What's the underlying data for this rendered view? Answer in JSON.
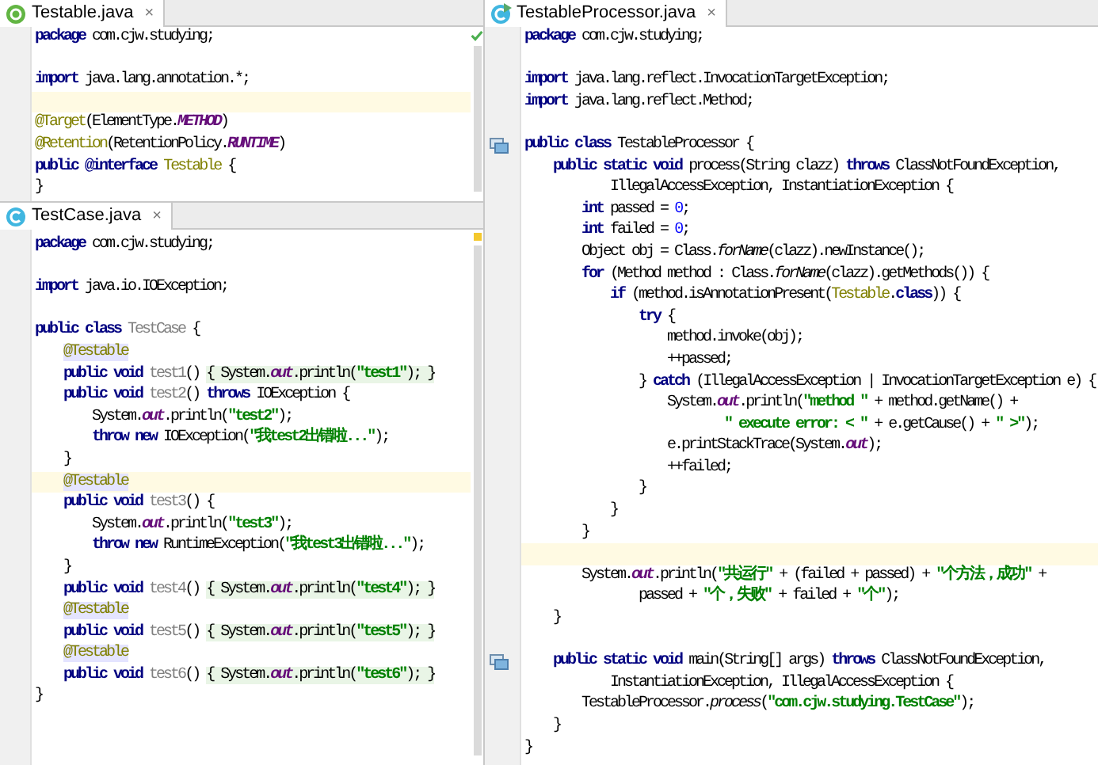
{
  "panes": [
    {
      "tab": {
        "label": "Testable.java",
        "close": "×",
        "selected": true
      },
      "lines": [
        {
          "current": false,
          "tokens": [
            {
              "kind": "keyword",
              "text": "package"
            },
            {
              "kind": "plain",
              "text": " com.cjw.studying;"
            }
          ]
        },
        {
          "current": false
        },
        {
          "current": false,
          "tokens": [
            {
              "kind": "keyword",
              "text": "import"
            },
            {
              "kind": "plain",
              "text": " java.lang.annotation.*;"
            }
          ]
        },
        {
          "current": true
        },
        {
          "current": false,
          "tokens": [
            {
              "kind": "annotation",
              "text": "@Target"
            },
            {
              "kind": "plain",
              "text": "(ElementType."
            },
            {
              "kind": "constant",
              "text": "METHOD"
            },
            {
              "kind": "plain",
              "text": ")"
            }
          ]
        },
        {
          "current": false,
          "tokens": [
            {
              "kind": "annotation",
              "text": "@Retention"
            },
            {
              "kind": "plain",
              "text": "(RetentionPolicy."
            },
            {
              "kind": "constant",
              "text": "RUNTIME"
            },
            {
              "kind": "plain",
              "text": ")"
            }
          ]
        },
        {
          "current": false,
          "tokens": [
            {
              "kind": "keyword",
              "text": "public"
            },
            {
              "kind": "keyword",
              "text": " @interface"
            },
            {
              "kind": "annotation",
              "text": " Testable"
            },
            {
              "kind": "plain",
              "text": " {"
            }
          ]
        },
        {
          "current": false,
          "tokens": [
            {
              "kind": "plain",
              "text": "}"
            }
          ]
        }
      ]
    },
    {
      "tab": {
        "label": "TestCase.java",
        "close": "×",
        "selected": true
      },
      "lines": [
        {
          "current": false,
          "tokens": [
            {
              "kind": "keyword",
              "text": "package"
            },
            {
              "kind": "plain",
              "text": " com.cjw.studying;"
            }
          ]
        },
        {
          "current": false
        },
        {
          "current": false,
          "tokens": [
            {
              "kind": "keyword",
              "text": "import"
            },
            {
              "kind": "plain",
              "text": " java.io.IOException;"
            }
          ]
        },
        {
          "current": false
        },
        {
          "current": false,
          "tokens": [
            {
              "kind": "keyword",
              "text": "public class"
            },
            {
              "kind": "unused",
              "text": " TestCase"
            },
            {
              "kind": "plain",
              "text": " {"
            }
          ]
        },
        {
          "current": false,
          "tokens": [
            {
              "kind": "usage",
              "text": "    @Testable"
            }
          ]
        },
        {
          "current": false,
          "tokens": [
            {
              "kind": "keyword",
              "text": "    public void"
            },
            {
              "kind": "unused",
              "text": " test1"
            },
            {
              "kind": "plain",
              "text": "() "
            }
          ],
          "fold": [
            {
              "kind": "plain",
              "text": "{ System."
            },
            {
              "kind": "field",
              "text": "out"
            },
            {
              "kind": "plain",
              "text": ".println("
            },
            {
              "kind": "string",
              "text": "\"test1\""
            },
            {
              "kind": "plain",
              "text": "); }"
            }
          ]
        },
        {
          "current": false,
          "tokens": [
            {
              "kind": "keyword",
              "text": "    public void"
            },
            {
              "kind": "unused",
              "text": " test2"
            },
            {
              "kind": "plain",
              "text": "() "
            },
            {
              "kind": "keyword",
              "text": "throws"
            },
            {
              "kind": "plain",
              "text": " IOException {"
            }
          ]
        },
        {
          "current": false,
          "tokens": [
            {
              "kind": "plain",
              "text": "        System."
            },
            {
              "kind": "field",
              "text": "out"
            },
            {
              "kind": "plain",
              "text": ".println("
            },
            {
              "kind": "string",
              "text": "\"test2\""
            },
            {
              "kind": "plain",
              "text": ");"
            }
          ]
        },
        {
          "current": false,
          "tokens": [
            {
              "kind": "keyword",
              "text": "        throw new"
            },
            {
              "kind": "plain",
              "text": " IOException("
            },
            {
              "kind": "string",
              "text": "\"我test2出错啦...\""
            },
            {
              "kind": "plain",
              "text": ");"
            }
          ]
        },
        {
          "current": false,
          "tokens": [
            {
              "kind": "plain",
              "text": "    }"
            }
          ]
        },
        {
          "current": true,
          "tokens": [
            {
              "kind": "usage",
              "text": "    @Testable"
            }
          ]
        },
        {
          "current": false,
          "tokens": [
            {
              "kind": "keyword",
              "text": "    public void"
            },
            {
              "kind": "unused",
              "text": " test3"
            },
            {
              "kind": "plain",
              "text": "() {"
            }
          ]
        },
        {
          "current": false,
          "tokens": [
            {
              "kind": "plain",
              "text": "        System."
            },
            {
              "kind": "field",
              "text": "out"
            },
            {
              "kind": "plain",
              "text": ".println("
            },
            {
              "kind": "string",
              "text": "\"test3\""
            },
            {
              "kind": "plain",
              "text": ");"
            }
          ]
        },
        {
          "current": false,
          "tokens": [
            {
              "kind": "keyword",
              "text": "        throw new"
            },
            {
              "kind": "plain",
              "text": " RuntimeException("
            },
            {
              "kind": "string",
              "text": "\"我test3出错啦...\""
            },
            {
              "kind": "plain",
              "text": ");"
            }
          ]
        },
        {
          "current": false,
          "tokens": [
            {
              "kind": "plain",
              "text": "    }"
            }
          ]
        },
        {
          "current": false,
          "tokens": [
            {
              "kind": "keyword",
              "text": "    public void"
            },
            {
              "kind": "unused",
              "text": " test4"
            },
            {
              "kind": "plain",
              "text": "() "
            }
          ],
          "fold": [
            {
              "kind": "plain",
              "text": "{ System."
            },
            {
              "kind": "field",
              "text": "out"
            },
            {
              "kind": "plain",
              "text": ".println("
            },
            {
              "kind": "string",
              "text": "\"test4\""
            },
            {
              "kind": "plain",
              "text": "); }"
            }
          ]
        },
        {
          "current": false,
          "tokens": [
            {
              "kind": "usage",
              "text": "    @Testable"
            }
          ]
        },
        {
          "current": false,
          "tokens": [
            {
              "kind": "keyword",
              "text": "    public void"
            },
            {
              "kind": "unused",
              "text": " test5"
            },
            {
              "kind": "plain",
              "text": "() "
            }
          ],
          "fold": [
            {
              "kind": "plain",
              "text": "{ System."
            },
            {
              "kind": "field",
              "text": "out"
            },
            {
              "kind": "plain",
              "text": ".println("
            },
            {
              "kind": "string",
              "text": "\"test5\""
            },
            {
              "kind": "plain",
              "text": "); }"
            }
          ]
        },
        {
          "current": false,
          "tokens": [
            {
              "kind": "usage",
              "text": "    @Testable"
            }
          ]
        },
        {
          "current": false,
          "tokens": [
            {
              "kind": "keyword",
              "text": "    public void"
            },
            {
              "kind": "unused",
              "text": " test6"
            },
            {
              "kind": "plain",
              "text": "() "
            }
          ],
          "fold": [
            {
              "kind": "plain",
              "text": "{ System."
            },
            {
              "kind": "field",
              "text": "out"
            },
            {
              "kind": "plain",
              "text": ".println("
            },
            {
              "kind": "string",
              "text": "\"test6\""
            },
            {
              "kind": "plain",
              "text": "); }"
            }
          ]
        },
        {
          "current": false,
          "tokens": [
            {
              "kind": "plain",
              "text": "}"
            }
          ]
        }
      ]
    },
    {
      "tab": {
        "label": "TestableProcessor.java",
        "close": "×",
        "selected": true
      },
      "lines": [
        {
          "current": false,
          "implemented": false,
          "tokens": [
            {
              "kind": "keyword",
              "text": "package"
            },
            {
              "kind": "plain",
              "text": " com.cjw.studying;"
            }
          ]
        },
        {
          "current": false,
          "implemented": false
        },
        {
          "current": false,
          "implemented": false,
          "tokens": [
            {
              "kind": "keyword",
              "text": "import"
            },
            {
              "kind": "plain",
              "text": " java.lang.reflect.InvocationTargetException;"
            }
          ]
        },
        {
          "current": false,
          "implemented": false,
          "tokens": [
            {
              "kind": "keyword",
              "text": "import"
            },
            {
              "kind": "plain",
              "text": " java.lang.reflect.Method;"
            }
          ]
        },
        {
          "current": false,
          "implemented": false
        },
        {
          "current": false,
          "implemented": true,
          "tokens": [
            {
              "kind": "keyword",
              "text": "public class"
            },
            {
              "kind": "plain",
              "text": " TestableProcessor {"
            }
          ]
        },
        {
          "current": false,
          "implemented": false,
          "tokens": [
            {
              "kind": "keyword",
              "text": "    public static void"
            },
            {
              "kind": "plain",
              "text": " process(String clazz) "
            },
            {
              "kind": "keyword",
              "text": "throws"
            },
            {
              "kind": "plain",
              "text": " ClassNotFoundException,"
            }
          ]
        },
        {
          "current": false,
          "implemented": false,
          "tokens": [
            {
              "kind": "plain",
              "text": "            IllegalAccessException, InstantiationException {"
            }
          ]
        },
        {
          "current": false,
          "implemented": false,
          "tokens": [
            {
              "kind": "keyword",
              "text": "        int"
            },
            {
              "kind": "plain",
              "text": " passed = "
            },
            {
              "kind": "number",
              "text": "0"
            },
            {
              "kind": "plain",
              "text": ";"
            }
          ]
        },
        {
          "current": false,
          "implemented": false,
          "tokens": [
            {
              "kind": "keyword",
              "text": "        int"
            },
            {
              "kind": "plain",
              "text": " failed = "
            },
            {
              "kind": "number",
              "text": "0"
            },
            {
              "kind": "plain",
              "text": ";"
            }
          ]
        },
        {
          "current": false,
          "implemented": false,
          "tokens": [
            {
              "kind": "plain",
              "text": "        Object obj = Class."
            },
            {
              "kind": "static_call",
              "text": "forName"
            },
            {
              "kind": "plain",
              "text": "(clazz).newInstance();"
            }
          ]
        },
        {
          "current": false,
          "implemented": false,
          "tokens": [
            {
              "kind": "keyword",
              "text": "        for"
            },
            {
              "kind": "plain",
              "text": " (Method method : Class."
            },
            {
              "kind": "static_call",
              "text": "forName"
            },
            {
              "kind": "plain",
              "text": "(clazz).getMethods()) {"
            }
          ]
        },
        {
          "current": false,
          "implemented": false,
          "tokens": [
            {
              "kind": "keyword",
              "text": "            if"
            },
            {
              "kind": "plain",
              "text": " (method.isAnnotationPresent("
            },
            {
              "kind": "annotation",
              "text": "Testable"
            },
            {
              "kind": "plain",
              "text": "."
            },
            {
              "kind": "keyword",
              "text": "class"
            },
            {
              "kind": "plain",
              "text": ")) {"
            }
          ]
        },
        {
          "current": false,
          "implemented": false,
          "tokens": [
            {
              "kind": "keyword",
              "text": "                try"
            },
            {
              "kind": "plain",
              "text": " {"
            }
          ]
        },
        {
          "current": false,
          "implemented": false,
          "tokens": [
            {
              "kind": "plain",
              "text": "                    method.invoke(obj);"
            }
          ]
        },
        {
          "current": false,
          "implemented": false,
          "tokens": [
            {
              "kind": "plain",
              "text": "                    ++passed;"
            }
          ]
        },
        {
          "current": false,
          "implemented": false,
          "tokens": [
            {
              "kind": "plain",
              "text": "                } "
            },
            {
              "kind": "keyword",
              "text": "catch"
            },
            {
              "kind": "plain",
              "text": " (IllegalAccessException | InvocationTargetException e) {"
            }
          ]
        },
        {
          "current": false,
          "implemented": false,
          "tokens": [
            {
              "kind": "plain",
              "text": "                    System."
            },
            {
              "kind": "field",
              "text": "out"
            },
            {
              "kind": "plain",
              "text": ".println("
            },
            {
              "kind": "string",
              "text": "\"method \""
            },
            {
              "kind": "plain",
              "text": " + method.getName() +"
            }
          ]
        },
        {
          "current": false,
          "implemented": false,
          "tokens": [
            {
              "kind": "string",
              "text": "                            \" execute error: < \""
            },
            {
              "kind": "plain",
              "text": " + e.getCause() + "
            },
            {
              "kind": "string",
              "text": "\" >\""
            },
            {
              "kind": "plain",
              "text": ");"
            }
          ]
        },
        {
          "current": false,
          "implemented": false,
          "tokens": [
            {
              "kind": "plain",
              "text": "                    e.printStackTrace(System."
            },
            {
              "kind": "field",
              "text": "out"
            },
            {
              "kind": "plain",
              "text": ");"
            }
          ]
        },
        {
          "current": false,
          "implemented": false,
          "tokens": [
            {
              "kind": "plain",
              "text": "                    ++failed;"
            }
          ]
        },
        {
          "current": false,
          "implemented": false,
          "tokens": [
            {
              "kind": "plain",
              "text": "                }"
            }
          ]
        },
        {
          "current": false,
          "implemented": false,
          "tokens": [
            {
              "kind": "plain",
              "text": "            }"
            }
          ]
        },
        {
          "current": false,
          "implemented": false,
          "tokens": [
            {
              "kind": "plain",
              "text": "        }"
            }
          ]
        },
        {
          "current": true,
          "implemented": false
        },
        {
          "current": false,
          "implemented": false,
          "tokens": [
            {
              "kind": "plain",
              "text": "        System."
            },
            {
              "kind": "field",
              "text": "out"
            },
            {
              "kind": "plain",
              "text": ".println("
            },
            {
              "kind": "string",
              "text": "\"共运行\""
            },
            {
              "kind": "plain",
              "text": " + (failed + passed) + "
            },
            {
              "kind": "string",
              "text": "\"个方法，成功\""
            },
            {
              "kind": "plain",
              "text": " +"
            }
          ]
        },
        {
          "current": false,
          "implemented": false,
          "tokens": [
            {
              "kind": "plain",
              "text": "                passed + "
            },
            {
              "kind": "string",
              "text": "\"个，失败\""
            },
            {
              "kind": "plain",
              "text": " + failed + "
            },
            {
              "kind": "string",
              "text": "\"个\""
            },
            {
              "kind": "plain",
              "text": ");"
            }
          ]
        },
        {
          "current": false,
          "implemented": false,
          "tokens": [
            {
              "kind": "plain",
              "text": "    }"
            }
          ]
        },
        {
          "current": false,
          "implemented": false
        },
        {
          "current": false,
          "implemented": true,
          "tokens": [
            {
              "kind": "keyword",
              "text": "    public static void"
            },
            {
              "kind": "plain",
              "text": " main(String[] args) "
            },
            {
              "kind": "keyword",
              "text": "throws"
            },
            {
              "kind": "plain",
              "text": " ClassNotFoundException,"
            }
          ]
        },
        {
          "current": false,
          "implemented": false,
          "tokens": [
            {
              "kind": "plain",
              "text": "            InstantiationException, IllegalAccessException {"
            }
          ]
        },
        {
          "current": false,
          "implemented": false,
          "tokens": [
            {
              "kind": "plain",
              "text": "        TestableProcessor."
            },
            {
              "kind": "static_call",
              "text": "process"
            },
            {
              "kind": "plain",
              "text": "("
            },
            {
              "kind": "string",
              "text": "\"com.cjw.studying.TestCase\""
            },
            {
              "kind": "plain",
              "text": ");"
            }
          ]
        },
        {
          "current": false,
          "implemented": false,
          "tokens": [
            {
              "kind": "plain",
              "text": "    }"
            }
          ]
        },
        {
          "current": false,
          "implemented": false,
          "tokens": [
            {
              "kind": "plain",
              "text": "}"
            }
          ]
        }
      ]
    }
  ]
}
